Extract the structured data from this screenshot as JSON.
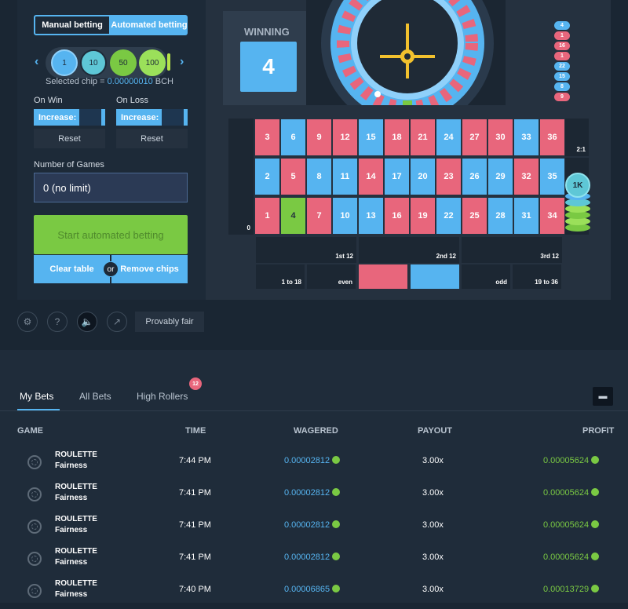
{
  "modes": {
    "manual": "Manual betting",
    "auto": "Automated betting"
  },
  "chips": [
    "1",
    "10",
    "50",
    "100"
  ],
  "selected_chip": {
    "label": "Selected chip = ",
    "value": "0.00000010",
    "unit": " BCH"
  },
  "on_win": {
    "label": "On Win",
    "field": "Increase:",
    "reset": "Reset"
  },
  "on_loss": {
    "label": "On Loss",
    "field": "Increase:",
    "reset": "Reset"
  },
  "games": {
    "label": "Number of Games",
    "value": "0 (no limit)"
  },
  "actions": {
    "start": "Start automated betting",
    "clear": "Clear table",
    "or": "or",
    "remove": "Remove chips"
  },
  "winning": {
    "label": "WINNING",
    "number": "4"
  },
  "history": [
    {
      "n": "4",
      "c": "blue"
    },
    {
      "n": "1",
      "c": "red"
    },
    {
      "n": "16",
      "c": "red"
    },
    {
      "n": "1",
      "c": "red"
    },
    {
      "n": "22",
      "c": "blue"
    },
    {
      "n": "15",
      "c": "blue"
    },
    {
      "n": "8",
      "c": "blue"
    },
    {
      "n": "9",
      "c": "red"
    }
  ],
  "board": {
    "zero": "0",
    "rows": [
      [
        {
          "n": "3",
          "c": "red"
        },
        {
          "n": "6",
          "c": "blue"
        },
        {
          "n": "9",
          "c": "red"
        },
        {
          "n": "12",
          "c": "red"
        },
        {
          "n": "15",
          "c": "blue"
        },
        {
          "n": "18",
          "c": "red"
        },
        {
          "n": "21",
          "c": "red"
        },
        {
          "n": "24",
          "c": "blue"
        },
        {
          "n": "27",
          "c": "red"
        },
        {
          "n": "30",
          "c": "red"
        },
        {
          "n": "33",
          "c": "blue"
        },
        {
          "n": "36",
          "c": "red"
        }
      ],
      [
        {
          "n": "2",
          "c": "blue"
        },
        {
          "n": "5",
          "c": "red"
        },
        {
          "n": "8",
          "c": "blue"
        },
        {
          "n": "11",
          "c": "blue"
        },
        {
          "n": "14",
          "c": "red"
        },
        {
          "n": "17",
          "c": "blue"
        },
        {
          "n": "20",
          "c": "blue"
        },
        {
          "n": "23",
          "c": "red"
        },
        {
          "n": "26",
          "c": "blue"
        },
        {
          "n": "29",
          "c": "blue"
        },
        {
          "n": "32",
          "c": "red"
        },
        {
          "n": "35",
          "c": "blue"
        }
      ],
      [
        {
          "n": "1",
          "c": "red"
        },
        {
          "n": "4",
          "c": "green"
        },
        {
          "n": "7",
          "c": "red"
        },
        {
          "n": "10",
          "c": "blue"
        },
        {
          "n": "13",
          "c": "blue"
        },
        {
          "n": "16",
          "c": "red"
        },
        {
          "n": "19",
          "c": "red"
        },
        {
          "n": "22",
          "c": "blue"
        },
        {
          "n": "25",
          "c": "red"
        },
        {
          "n": "28",
          "c": "blue"
        },
        {
          "n": "31",
          "c": "blue"
        },
        {
          "n": "34",
          "c": "red"
        }
      ]
    ],
    "column_bet": "2:1",
    "chip_stack": "1K",
    "dozens": [
      "1st 12",
      "2nd 12",
      "3rd 12"
    ],
    "outside": [
      "1 to 18",
      "even",
      "",
      "",
      "odd",
      "19 to 36"
    ]
  },
  "toolbar": {
    "provably_fair": "Provably fair"
  },
  "tabs": {
    "my": "My Bets",
    "all": "All Bets",
    "high": "High Rollers",
    "badge": "12"
  },
  "columns": {
    "game": "GAME",
    "time": "TIME",
    "wagered": "WAGERED",
    "payout": "PAYOUT",
    "profit": "PROFIT"
  },
  "bets": [
    {
      "game": "ROULETTE",
      "fair": "Fairness",
      "time": "7:44 PM",
      "wagered": "0.00002812",
      "payout": "3.00x",
      "profit": "0.00005624"
    },
    {
      "game": "ROULETTE",
      "fair": "Fairness",
      "time": "7:41 PM",
      "wagered": "0.00002812",
      "payout": "3.00x",
      "profit": "0.00005624"
    },
    {
      "game": "ROULETTE",
      "fair": "Fairness",
      "time": "7:41 PM",
      "wagered": "0.00002812",
      "payout": "3.00x",
      "profit": "0.00005624"
    },
    {
      "game": "ROULETTE",
      "fair": "Fairness",
      "time": "7:41 PM",
      "wagered": "0.00002812",
      "payout": "3.00x",
      "profit": "0.00005624"
    },
    {
      "game": "ROULETTE",
      "fair": "Fairness",
      "time": "7:40 PM",
      "wagered": "0.00006865",
      "payout": "3.00x",
      "profit": "0.00013729"
    }
  ],
  "colors": {
    "blue": "#56b4f0",
    "red": "#e8667c",
    "green": "#7ac943"
  }
}
